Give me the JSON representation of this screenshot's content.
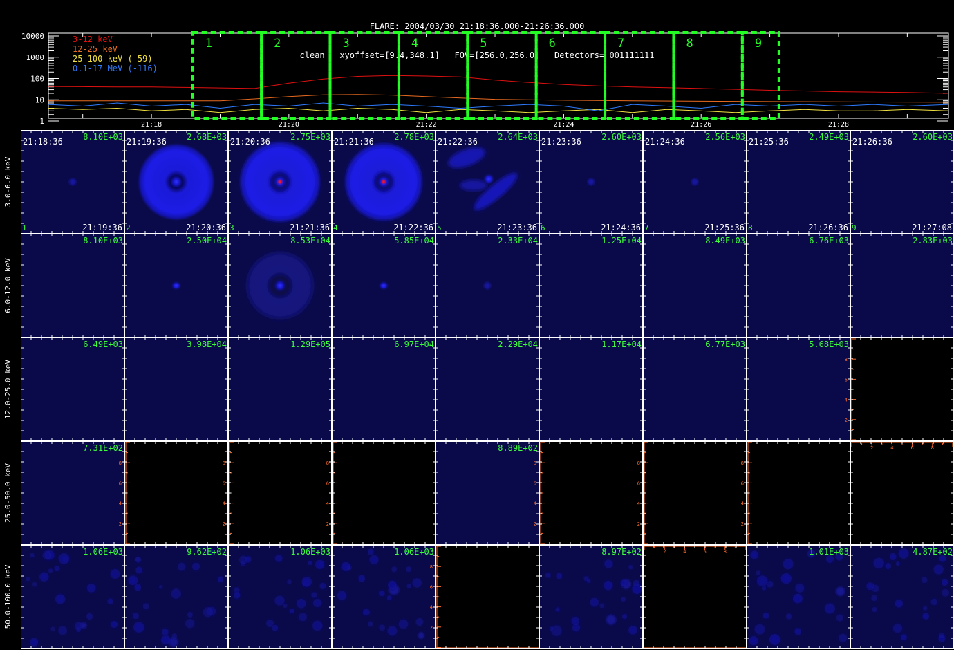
{
  "header": {
    "line1": "FLARE: 2004/03/30 21:18:36.000-21:26:36.000",
    "line2": "clean   xyoffset=[9.4,348.1]   FOV=[256.0,256.0]   Detectors= 001111111"
  },
  "chart_data": [
    {
      "type": "line",
      "yscale": "log",
      "ylim": [
        1,
        10000
      ],
      "ytick_labels": [
        "1",
        "10",
        "100",
        "1000",
        "10000"
      ],
      "xlim_minutes": [
        "21:16:30",
        "21:29:36"
      ],
      "xtick_labels": [
        "21:18",
        "21:20",
        "21:22",
        "21:24",
        "21:26",
        "21:28"
      ],
      "legend": [
        {
          "label": "3-12 keV",
          "color": "#e01010"
        },
        {
          "label": "12-25 keV",
          "color": "#e86a20"
        },
        {
          "label": "25-100 keV (-59)",
          "color": "#f0e040"
        },
        {
          "label": "0.1-17 MeV (-116)",
          "color": "#2e7bff"
        }
      ],
      "series": [
        {
          "name": "3-12 keV",
          "color": "#e01010",
          "x": [
            "21:16:30",
            "21:17:00",
            "21:17:30",
            "21:18:00",
            "21:18:30",
            "21:19:00",
            "21:19:30",
            "21:20:00",
            "21:20:30",
            "21:21:00",
            "21:21:30",
            "21:22:00",
            "21:22:30",
            "21:23:00",
            "21:23:30",
            "21:24:00",
            "21:24:30",
            "21:25:00",
            "21:25:30",
            "21:26:00",
            "21:26:30",
            "21:27:00",
            "21:27:30",
            "21:28:00",
            "21:28:30",
            "21:29:00",
            "21:29:36"
          ],
          "values": [
            42,
            41,
            40,
            40,
            38,
            36,
            34,
            60,
            95,
            125,
            138,
            130,
            118,
            85,
            65,
            52,
            45,
            40,
            37,
            34,
            31,
            28,
            26,
            24,
            23,
            22,
            20
          ]
        },
        {
          "name": "12-25 keV",
          "color": "#e86a20",
          "x": [
            "21:16:30",
            "21:17:30",
            "21:18:30",
            "21:19:00",
            "21:19:30",
            "21:20:00",
            "21:20:30",
            "21:21:00",
            "21:21:30",
            "21:22:00",
            "21:22:30",
            "21:23:00",
            "21:23:30",
            "21:24:00",
            "21:25:00",
            "21:26:00",
            "21:27:00",
            "21:28:00",
            "21:29:36"
          ],
          "values": [
            9,
            9,
            9,
            9,
            11,
            14,
            17,
            17.5,
            16.5,
            14,
            12,
            10.5,
            10,
            9.5,
            9,
            8.5,
            8.2,
            8,
            7.6
          ]
        },
        {
          "name": "25-100 keV (-59)",
          "color": "#f0e040",
          "x": [
            "21:16:30",
            "21:17:00",
            "21:17:30",
            "21:18:00",
            "21:18:30",
            "21:19:00",
            "21:19:30",
            "21:20:00",
            "21:20:30",
            "21:21:00",
            "21:21:30",
            "21:22:00",
            "21:22:30",
            "21:23:00",
            "21:23:30",
            "21:24:00",
            "21:24:30",
            "21:25:00",
            "21:25:30",
            "21:26:00",
            "21:26:30",
            "21:27:00",
            "21:27:30",
            "21:28:00",
            "21:28:30",
            "21:29:00",
            "21:29:36"
          ],
          "values": [
            4,
            3.5,
            4,
            3,
            3.5,
            2.5,
            3.5,
            4,
            3,
            4,
            3.5,
            2.5,
            3.5,
            3,
            2.5,
            3,
            3.5,
            2.5,
            3.5,
            3,
            2.5,
            3,
            3.5,
            3,
            3,
            3.5,
            3
          ]
        },
        {
          "name": "0.1-17 MeV (-116)",
          "color": "#2e7bff",
          "x": [
            "21:16:30",
            "21:17:00",
            "21:17:30",
            "21:18:00",
            "21:18:30",
            "21:19:00",
            "21:19:30",
            "21:20:00",
            "21:20:30",
            "21:21:00",
            "21:21:30",
            "21:22:00",
            "21:22:30",
            "21:23:00",
            "21:23:30",
            "21:24:00",
            "21:24:30",
            "21:25:00",
            "21:25:30",
            "21:26:00",
            "21:26:30",
            "21:27:00",
            "21:27:30",
            "21:28:00",
            "21:28:30",
            "21:29:00",
            "21:29:36"
          ],
          "values": [
            6,
            5,
            7,
            5,
            6,
            4,
            6,
            5,
            7,
            5,
            6,
            5,
            4,
            5,
            6,
            5,
            3,
            6,
            5,
            4,
            6,
            5,
            6,
            5,
            6,
            5,
            6
          ]
        }
      ],
      "intervals": [
        {
          "label": "1",
          "start": "21:18:36",
          "end": "21:19:36"
        },
        {
          "label": "2",
          "start": "21:19:36",
          "end": "21:20:36"
        },
        {
          "label": "3",
          "start": "21:20:36",
          "end": "21:21:36"
        },
        {
          "label": "4",
          "start": "21:21:36",
          "end": "21:22:36"
        },
        {
          "label": "5",
          "start": "21:22:36",
          "end": "21:23:36"
        },
        {
          "label": "6",
          "start": "21:23:36",
          "end": "21:24:36"
        },
        {
          "label": "7",
          "start": "21:24:36",
          "end": "21:25:36"
        },
        {
          "label": "8",
          "start": "21:25:36",
          "end": "21:26:36"
        },
        {
          "label": "9",
          "start": "21:26:36",
          "end": "21:27:08"
        }
      ]
    },
    {
      "type": "heatmap",
      "rows": [
        {
          "label": "3.0-6.0 keV",
          "cells": [
            {
              "max": "8.10E+03",
              "t0": "21:18:36",
              "t1": "21:19:36",
              "idx": "1",
              "img": "faint"
            },
            {
              "max": "2.68E+03",
              "t0": "21:19:36",
              "t1": "21:20:36",
              "idx": "2",
              "img": "ring-med"
            },
            {
              "max": "2.75E+03",
              "t0": "21:20:36",
              "t1": "21:21:36",
              "idx": "3",
              "img": "ring-big"
            },
            {
              "max": "2.78E+03",
              "t0": "21:21:36",
              "t1": "21:22:36",
              "idx": "4",
              "img": "ring-large"
            },
            {
              "max": "2.64E+03",
              "t0": "21:22:36",
              "t1": "21:23:36",
              "idx": "5",
              "img": "blobs"
            },
            {
              "max": "2.60E+03",
              "t0": "21:23:36",
              "t1": "21:24:36",
              "idx": "6",
              "img": "faint"
            },
            {
              "max": "2.56E+03",
              "t0": "21:24:36",
              "t1": "21:25:36",
              "idx": "7",
              "img": "faint"
            },
            {
              "max": "2.49E+03",
              "t0": "21:25:36",
              "t1": "21:26:36",
              "idx": "8",
              "img": "blank"
            },
            {
              "max": "2.60E+03",
              "t0": "21:26:36",
              "t1": "21:27:08",
              "idx": "9",
              "img": "blank"
            }
          ]
        },
        {
          "label": "6.0-12.0 keV",
          "cells": [
            {
              "max": "8.10E+03",
              "img": "blank"
            },
            {
              "max": "2.50E+04",
              "img": "dot"
            },
            {
              "max": "8.53E+04",
              "img": "ring-faint"
            },
            {
              "max": "5.85E+04",
              "img": "dot"
            },
            {
              "max": "2.33E+04",
              "img": "dot-faint"
            },
            {
              "max": "1.25E+04",
              "img": "blank"
            },
            {
              "max": "8.49E+03",
              "img": "blank"
            },
            {
              "max": "6.76E+03",
              "img": "blank"
            },
            {
              "max": "2.83E+03",
              "img": "blank"
            }
          ]
        },
        {
          "label": "12.0-25.0 keV",
          "cells": [
            {
              "max": "6.49E+03",
              "img": "blank"
            },
            {
              "max": "3.98E+04",
              "img": "blank"
            },
            {
              "max": "1.29E+05",
              "img": "blank"
            },
            {
              "max": "6.97E+04",
              "img": "blank"
            },
            {
              "max": "2.29E+04",
              "img": "blank"
            },
            {
              "max": "1.17E+04",
              "img": "blank"
            },
            {
              "max": "6.77E+03",
              "img": "blank"
            },
            {
              "max": "5.68E+03",
              "img": "blank"
            },
            {
              "max": "",
              "img": "empty"
            }
          ]
        },
        {
          "label": "25.0-50.0 keV",
          "cells": [
            {
              "max": "7.31E+02",
              "img": "blank"
            },
            {
              "max": "",
              "img": "empty"
            },
            {
              "max": "",
              "img": "empty"
            },
            {
              "max": "",
              "img": "empty"
            },
            {
              "max": "8.89E+02",
              "img": "blank"
            },
            {
              "max": "",
              "img": "empty"
            },
            {
              "max": "",
              "img": "empty"
            },
            {
              "max": "",
              "img": "empty"
            },
            {
              "max": "",
              "img": "empty"
            }
          ]
        },
        {
          "label": "50.0-100.0 keV",
          "cells": [
            {
              "max": "1.06E+03",
              "img": "noise"
            },
            {
              "max": "9.62E+02",
              "img": "noise"
            },
            {
              "max": "1.06E+03",
              "img": "noise"
            },
            {
              "max": "1.06E+03",
              "img": "noise"
            },
            {
              "max": "",
              "img": "empty"
            },
            {
              "max": "8.97E+02",
              "img": "noise"
            },
            {
              "max": "",
              "img": "empty"
            },
            {
              "max": "1.01E+03",
              "img": "noise"
            },
            {
              "max": "4.87E+02",
              "img": "noise"
            }
          ]
        }
      ],
      "empty_axis_ticks": [
        "2",
        "4",
        "6",
        "8"
      ]
    }
  ],
  "colors": {
    "background": "#000000",
    "panel": "#0a0a4a",
    "empty_axis": "#ff6a2a",
    "max_label": "#3cff3c",
    "interval_box": "#22ff22"
  }
}
